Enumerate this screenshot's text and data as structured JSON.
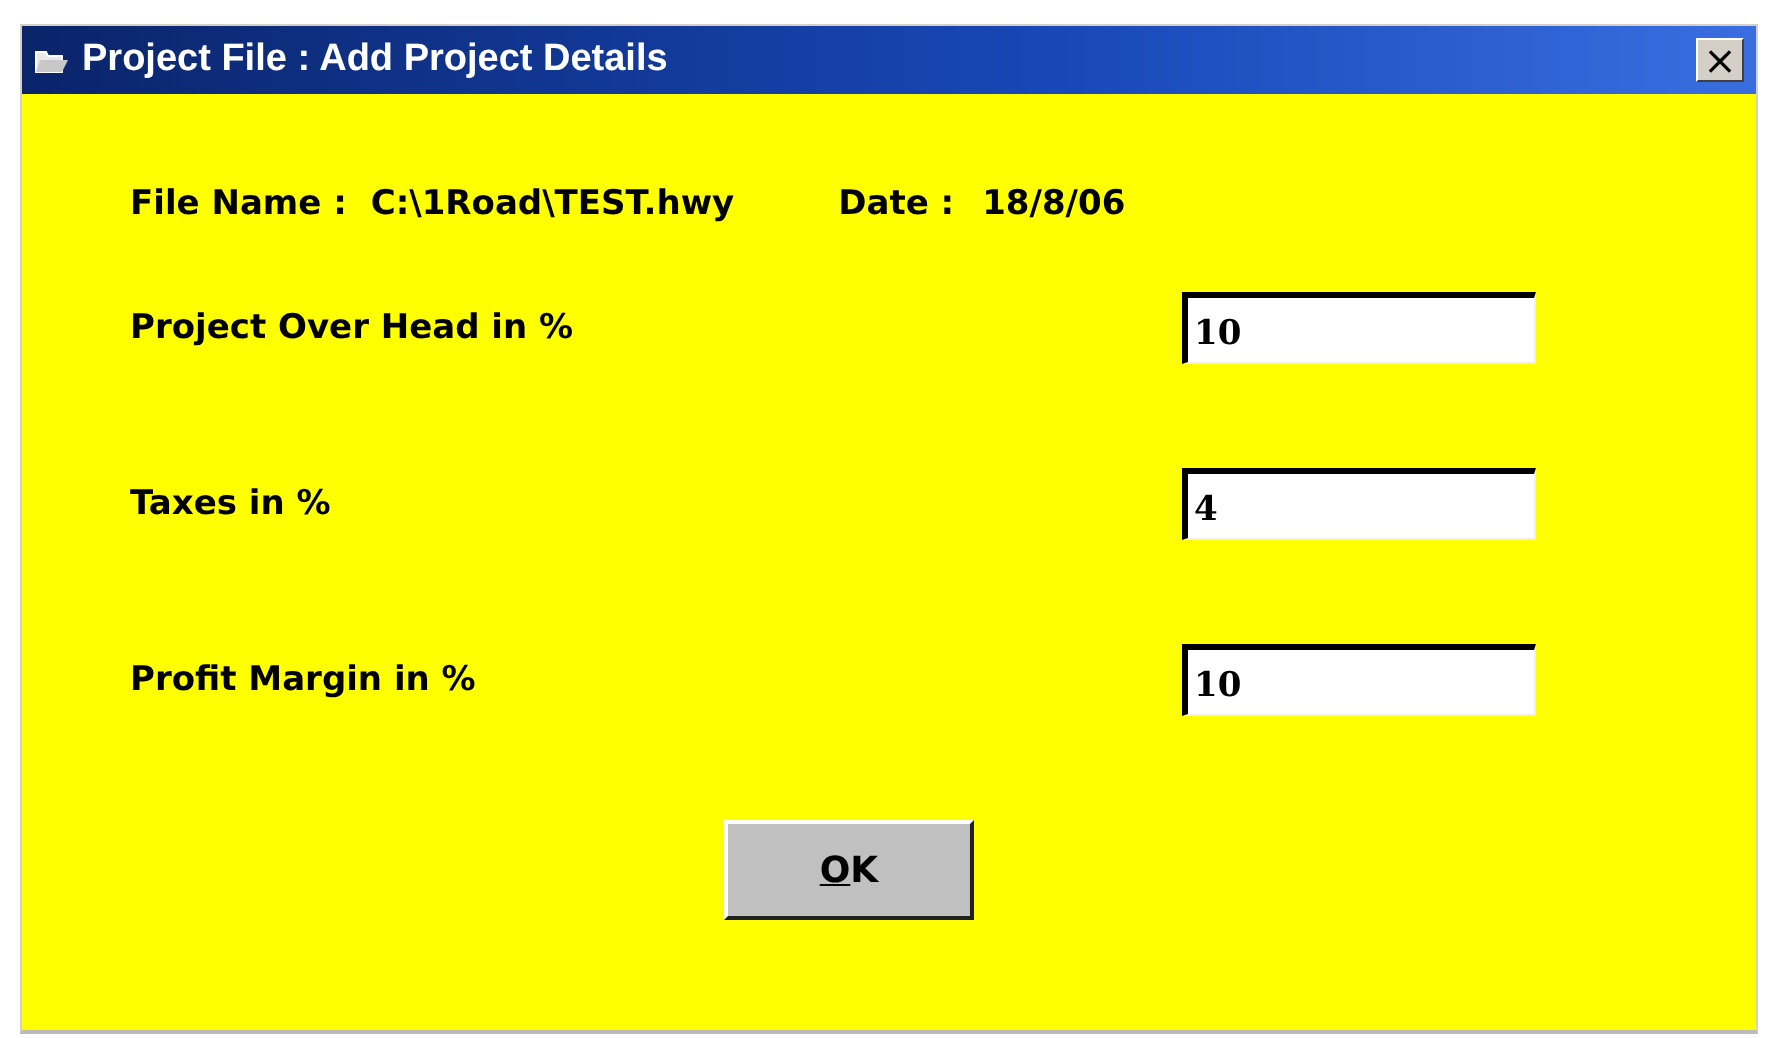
{
  "window": {
    "title": "Project File : Add Project Details",
    "close": "×"
  },
  "file_name": {
    "label": "File Name :",
    "value": "C:\\1Road\\TEST.hwy"
  },
  "date": {
    "label": "Date :",
    "value": "18/8/06"
  },
  "fields": [
    {
      "label": "Project Over Head in %",
      "value": "10"
    },
    {
      "label": "Taxes in %",
      "value": "4"
    },
    {
      "label": "Profit Margin in %",
      "value": "10"
    }
  ],
  "ok_button": {
    "mnemonic": "O",
    "rest": "K"
  }
}
